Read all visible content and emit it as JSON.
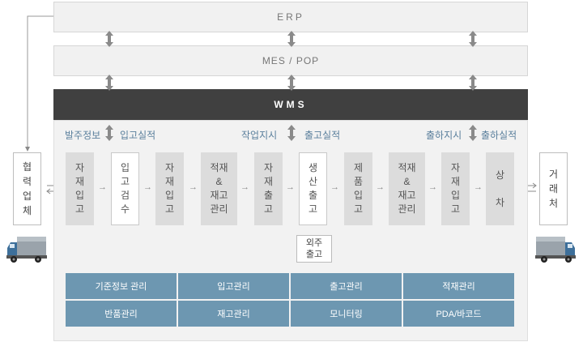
{
  "layers": {
    "erp": "ERP",
    "mes": "MES / POP",
    "wms": "WMS"
  },
  "flow_labels": [
    "발주정보",
    "입고실적",
    "작업지시",
    "출고실적",
    "출하지시",
    "출하실적"
  ],
  "external": {
    "supplier": "협\n력\n업\n체",
    "customer": "거\n래\n처"
  },
  "process": [
    "자\n재\n입\n고",
    "입\n고\n검\n수",
    "자\n재\n입\n고",
    "적재\n&\n재고\n관리",
    "자\n재\n출\n고",
    "생\n산\n출\n고",
    "제\n품\n입\n고",
    "적재\n&\n재고\n관리",
    "자\n재\n입\n고",
    "상\n\n차"
  ],
  "outsourcing": "외주\n출고",
  "features": [
    "기준정보 관리",
    "입고관리",
    "출고관리",
    "적재관리",
    "반품관리",
    "재고관리",
    "모니터링",
    "PDA/바코드"
  ],
  "colors": {
    "wms_bar": "#404040",
    "feature_tile": "#6d97b1",
    "label_blue": "#5a7f9c"
  },
  "icons": [
    "left-truck-icon",
    "right-truck-icon"
  ]
}
